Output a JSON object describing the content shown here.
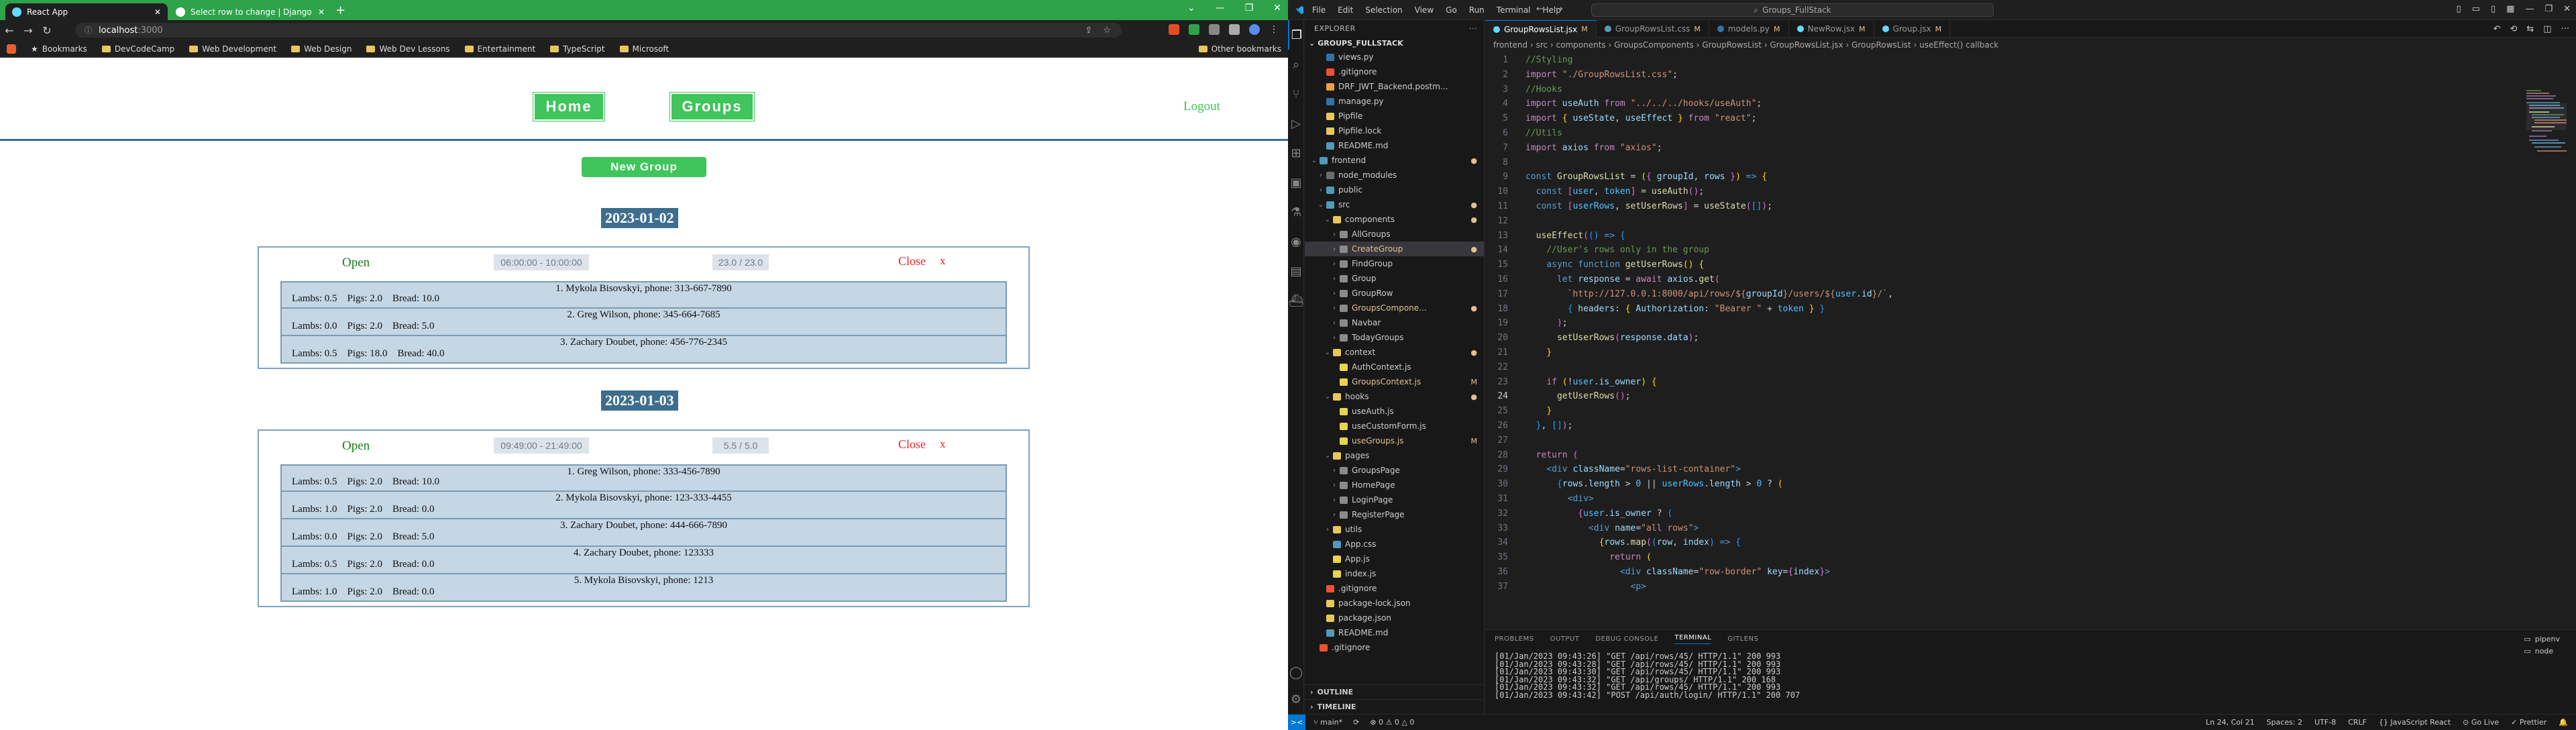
{
  "browser": {
    "tabs": [
      {
        "label": "React App",
        "favicon_color": "#61dafb"
      },
      {
        "label": "Select row to change | Django site",
        "favicon_color": "#ffffff"
      }
    ],
    "new_tab": "+",
    "window_controls": [
      "⌄",
      "—",
      "❐",
      "✕"
    ],
    "url": {
      "host": "localhost",
      "port": ":3000"
    },
    "bookmarks": [
      "Bookmarks",
      "DevCodeCamp",
      "Web Development",
      "Web Design",
      "Web Dev Lessons",
      "Entertainment",
      "TypeScript",
      "Microsoft"
    ],
    "other_bookmarks": "Other bookmarks"
  },
  "app": {
    "nav": {
      "home": "Home",
      "groups": "Groups",
      "logout": "Logout"
    },
    "new_group": "New Group",
    "groups": [
      {
        "date": "2023-01-02",
        "status": "Open",
        "time": "06:00:00 - 10:00:00",
        "count": "23.0 / 23.0",
        "close": "Close",
        "x": "x",
        "rows": [
          {
            "name": "1. Mykola Bisovskyi, phone: 313-667-7890",
            "values": "Lambs: 0.5    Pigs: 2.0    Bread: 10.0"
          },
          {
            "name": "2. Greg Wilson, phone: 345-664-7685",
            "values": "Lambs: 0.0    Pigs: 2.0    Bread: 5.0"
          },
          {
            "name": "3. Zachary Doubet, phone: 456-776-2345",
            "values": "Lambs: 0.5    Pigs: 18.0    Bread: 40.0"
          }
        ]
      },
      {
        "date": "2023-01-03",
        "status": "Open",
        "time": "09:49:00 - 21:49:00",
        "count": "5.5 / 5.0",
        "close": "Close",
        "x": "x",
        "rows": [
          {
            "name": "1. Greg Wilson, phone: 333-456-7890",
            "values": "Lambs: 0.5    Pigs: 2.0    Bread: 10.0"
          },
          {
            "name": "2. Mykola Bisovskyi, phone: 123-333-4455",
            "values": "Lambs: 1.0    Pigs: 2.0    Bread: 0.0"
          },
          {
            "name": "3. Zachary Doubet, phone: 444-666-7890",
            "values": "Lambs: 0.0    Pigs: 2.0    Bread: 5.0"
          },
          {
            "name": "4. Zachary Doubet, phone: 123333",
            "values": "Lambs: 0.5    Pigs: 2.0    Bread: 0.0"
          },
          {
            "name": "5. Mykola Bisovskyi, phone: 1213",
            "values": "Lambs: 1.0    Pigs: 2.0    Bread: 0.0"
          }
        ]
      }
    ]
  },
  "vscode": {
    "menu": [
      "File",
      "Edit",
      "Selection",
      "View",
      "Go",
      "Run",
      "Terminal",
      "Help"
    ],
    "search": "Groups_FullStack",
    "explorer_title": "EXPLORER",
    "root": "GROUPS_FULLSTACK",
    "tree": [
      {
        "label": "views.py",
        "indent": 1,
        "color": "#3572a5"
      },
      {
        "label": ".gitignore",
        "indent": 1,
        "color": "#f05033"
      },
      {
        "label": "DRF_JWT_Backend.postm...",
        "indent": 1,
        "color": "#e8a33d"
      },
      {
        "label": "manage.py",
        "indent": 1,
        "color": "#3572a5"
      },
      {
        "label": "Pipfile",
        "indent": 1,
        "color": "#e8c65b"
      },
      {
        "label": "Pipfile.lock",
        "indent": 1,
        "color": "#e8c65b"
      },
      {
        "label": "README.md",
        "indent": 1,
        "color": "#519aba"
      },
      {
        "label": "frontend",
        "indent": 0,
        "color": "#519aba",
        "folder": true,
        "open": true,
        "mark": "●",
        "mark_color": "#e2c08d"
      },
      {
        "label": "node_modules",
        "indent": 1,
        "color": "#6c6c6c",
        "folder": true
      },
      {
        "label": "public",
        "indent": 1,
        "color": "#519aba",
        "folder": true
      },
      {
        "label": "src",
        "indent": 1,
        "color": "#519aba",
        "folder": true,
        "open": true,
        "mark": "●",
        "mark_color": "#e2c08d"
      },
      {
        "label": "components",
        "indent": 2,
        "color": "#e8c65b",
        "folder": true,
        "open": true,
        "mark": "●",
        "mark_color": "#e2c08d"
      },
      {
        "label": "AllGroups",
        "indent": 3,
        "color": "#8a8a8a",
        "folder": true
      },
      {
        "label": "CreateGroup",
        "indent": 3,
        "color": "#8a8a8a",
        "folder": true,
        "mark": "●",
        "mark_color": "#e2c08d",
        "label_color": "#e2c08d"
      },
      {
        "label": "FindGroup",
        "indent": 3,
        "color": "#8a8a8a",
        "folder": true
      },
      {
        "label": "Group",
        "indent": 3,
        "color": "#8a8a8a",
        "folder": true
      },
      {
        "label": "GroupRow",
        "indent": 3,
        "color": "#8a8a8a",
        "folder": true
      },
      {
        "label": "GroupsCompone...",
        "indent": 3,
        "color": "#8a8a8a",
        "folder": true,
        "mark": "●",
        "mark_color": "#e2c08d",
        "label_color": "#e2c08d"
      },
      {
        "label": "Navbar",
        "indent": 3,
        "color": "#8a8a8a",
        "folder": true
      },
      {
        "label": "TodayGroups",
        "indent": 3,
        "color": "#8a8a8a",
        "folder": true
      },
      {
        "label": "context",
        "indent": 2,
        "color": "#e8c65b",
        "folder": true,
        "open": true,
        "mark": "●",
        "mark_color": "#e2c08d"
      },
      {
        "label": "AuthContext.js",
        "indent": 3,
        "color": "#e8d44d"
      },
      {
        "label": "GroupsContext.js",
        "indent": 3,
        "color": "#e8d44d",
        "mark": "M",
        "mark_color": "#e2c08d",
        "label_color": "#e2c08d"
      },
      {
        "label": "hooks",
        "indent": 2,
        "color": "#e8c65b",
        "folder": true,
        "open": true,
        "mark": "●",
        "mark_color": "#e2c08d"
      },
      {
        "label": "useAuth.js",
        "indent": 3,
        "color": "#e8d44d"
      },
      {
        "label": "useCustomForm.js",
        "indent": 3,
        "color": "#e8d44d"
      },
      {
        "label": "useGroups.js",
        "indent": 3,
        "color": "#e8d44d",
        "mark": "M",
        "mark_color": "#e2c08d",
        "label_color": "#e2c08d"
      },
      {
        "label": "pages",
        "indent": 2,
        "color": "#e8c65b",
        "folder": true,
        "open": true
      },
      {
        "label": "GroupsPage",
        "indent": 3,
        "color": "#8a8a8a",
        "folder": true
      },
      {
        "label": "HomePage",
        "indent": 3,
        "color": "#8a8a8a",
        "folder": true
      },
      {
        "label": "LoginPage",
        "indent": 3,
        "color": "#8a8a8a",
        "folder": true
      },
      {
        "label": "RegisterPage",
        "indent": 3,
        "color": "#8a8a8a",
        "folder": true
      },
      {
        "label": "utils",
        "indent": 2,
        "color": "#e8c65b",
        "folder": true
      },
      {
        "label": "App.css",
        "indent": 2,
        "color": "#519aba"
      },
      {
        "label": "App.js",
        "indent": 2,
        "color": "#e8d44d"
      },
      {
        "label": "index.js",
        "indent": 2,
        "color": "#e8d44d"
      },
      {
        "label": ".gitignore",
        "indent": 1,
        "color": "#f05033"
      },
      {
        "label": "package-lock.json",
        "indent": 1,
        "color": "#e8c65b"
      },
      {
        "label": "package.json",
        "indent": 1,
        "color": "#e8c65b"
      },
      {
        "label": "README.md",
        "indent": 1,
        "color": "#519aba"
      },
      {
        "label": ".gitignore",
        "indent": 0,
        "color": "#f05033"
      }
    ],
    "outline": "OUTLINE",
    "timeline": "TIMELINE",
    "editor_tabs": [
      {
        "label": "GroupRowsList.jsx",
        "mark": "M",
        "active": true,
        "color": "#61dafb"
      },
      {
        "label": "GroupRowsList.css",
        "mark": "M",
        "active": false,
        "color": "#519aba"
      },
      {
        "label": "models.py",
        "mark": "M",
        "active": false,
        "color": "#3572a5"
      },
      {
        "label": "NewRow.jsx",
        "mark": "M",
        "active": false,
        "color": "#61dafb"
      },
      {
        "label": "Group.jsx",
        "mark": "M",
        "active": false,
        "color": "#61dafb"
      }
    ],
    "breadcrumb": "frontend › src › components › GroupsComponents › GroupRowsList › GroupRowsList.jsx › GroupRowsList › useEffect() callback",
    "code_lines": [
      {
        "n": "1",
        "html": "<span class='cm'>//Styling</span>"
      },
      {
        "n": "2",
        "html": "<span class='k'>import</span> <span class='str'>\"./GroupRowsList.css\"</span>;"
      },
      {
        "n": "3",
        "html": "<span class='cm'>//Hooks</span>"
      },
      {
        "n": "4",
        "html": "<span class='k'>import</span> <span class='var'>useAuth</span> <span class='k'>from</span> <span class='str'>\"../../../hooks/useAuth\"</span>;"
      },
      {
        "n": "5",
        "html": "<span class='k'>import</span> <span class='br'>{</span> <span class='var'>useState</span>, <span class='var'>useEffect</span> <span class='br'>}</span> <span class='k'>from</span> <span class='str'>\"react\"</span>;"
      },
      {
        "n": "6",
        "html": "<span class='cm'>//Utils</span>"
      },
      {
        "n": "7",
        "html": "<span class='k'>import</span> <span class='var'>axios</span> <span class='k'>from</span> <span class='str'>\"axios\"</span>;"
      },
      {
        "n": "8",
        "html": ""
      },
      {
        "n": "9",
        "html": "<span class='kw'>const</span> <span class='fn'>GroupRowsList</span> = <span class='br'>(</span><span class='br2'>{</span> <span class='var'>groupId</span>, <span class='var'>rows</span> <span class='br2'>}</span><span class='br'>)</span> <span class='kw'>=&gt;</span> <span class='br'>{</span>"
      },
      {
        "n": "10",
        "html": "  <span class='kw'>const</span> <span class='br2'>[</span><span class='cn'>user</span>, <span class='cn'>token</span><span class='br2'>]</span> = <span class='fn'>useAuth</span><span class='br2'>()</span>;"
      },
      {
        "n": "11",
        "html": "  <span class='kw'>const</span> <span class='br2'>[</span><span class='cn'>userRows</span>, <span class='fn'>setUserRows</span><span class='br2'>]</span> = <span class='fn'>useState</span><span class='br2'>(</span><span class='br3'>[]</span><span class='br2'>)</span>;"
      },
      {
        "n": "12",
        "html": ""
      },
      {
        "n": "13",
        "html": "  <span class='fn'>useEffect</span><span class='br2'>(</span><span class='br3'>()</span> <span class='kw'>=&gt;</span> <span class='br3'>{</span>"
      },
      {
        "n": "14",
        "html": "    <span class='cm'>//User's rows only in the group</span>"
      },
      {
        "n": "15",
        "html": "    <span class='kw'>async</span> <span class='kw'>function</span> <span class='fn'>getUserRows</span><span class='br'>()</span> <span class='br'>{</span>"
      },
      {
        "n": "16",
        "html": "      <span class='kw'>let</span> <span class='var'>response</span> = <span class='k'>await</span> <span class='var'>axios</span>.<span class='fn'>get</span><span class='br2'>(</span>"
      },
      {
        "n": "17",
        "html": "        <span class='str'>`http://127.0.0.1:8000/api/rows/${</span><span class='var'>groupId</span><span class='str'>}/users/${</span><span class='cn'>user</span>.<span class='var'>id</span><span class='str'>}/`</span>,"
      },
      {
        "n": "18",
        "html": "        <span class='br3'>{</span> <span class='var'>headers</span>: <span class='br'>{</span> <span class='var'>Authorization</span>: <span class='str'>\"Bearer \"</span> + <span class='cn'>token</span> <span class='br'>}</span> <span class='br3'>}</span>"
      },
      {
        "n": "19",
        "html": "      <span class='br2'>)</span>;"
      },
      {
        "n": "20",
        "html": "      <span class='fn'>setUserRows</span><span class='br2'>(</span><span class='var'>response</span>.<span class='var'>data</span><span class='br2'>)</span>;"
      },
      {
        "n": "21",
        "html": "    <span class='br'>}</span>"
      },
      {
        "n": "22",
        "html": ""
      },
      {
        "n": "23",
        "html": "    <span class='k'>if</span> <span class='br'>(</span>!<span class='cn'>user</span>.<span class='var'>is_owner</span><span class='br'>)</span> <span class='br'>{</span>"
      },
      {
        "n": "24",
        "html": "      <span class='fn'>getUserRows</span><span class='br2'>()</span>;"
      },
      {
        "n": "25",
        "html": "    <span class='br'>}</span>"
      },
      {
        "n": "26",
        "html": "  <span class='br3'>}</span>, <span class='br3'>[]</span><span class='br2'>)</span>;"
      },
      {
        "n": "27",
        "html": ""
      },
      {
        "n": "28",
        "html": "  <span class='k'>return</span> <span class='br2'>(</span>"
      },
      {
        "n": "29",
        "html": "    <span class='kw'>&lt;</span><span class='kw'>div</span> <span class='var'>className</span>=<span class='str'>\"rows-list-container\"</span><span class='kw'>&gt;</span>"
      },
      {
        "n": "30",
        "html": "      <span class='br3'>{</span><span class='var'>rows</span>.<span class='var'>length</span> &gt; <span class='cn'>0</span> || <span class='cn'>userRows</span>.<span class='var'>length</span> &gt; <span class='cn'>0</span> ? <span class='br'>(</span>"
      },
      {
        "n": "31",
        "html": "        <span class='kw'>&lt;</span><span class='kw'>div</span><span class='kw'>&gt;</span>"
      },
      {
        "n": "32",
        "html": "          <span class='br2'>{</span><span class='cn'>user</span>.<span class='var'>is_owner</span> ? <span class='br3'>(</span>"
      },
      {
        "n": "33",
        "html": "            <span class='kw'>&lt;</span><span class='kw'>div</span> <span class='var'>name</span>=<span class='str'>\"all rows\"</span><span class='kw'>&gt;</span>"
      },
      {
        "n": "34",
        "html": "              <span class='br'>{</span><span class='var'>rows</span>.<span class='fn'>map</span><span class='br2'>(</span><span class='br3'>(</span><span class='var'>row</span>, <span class='var'>index</span><span class='br3'>)</span> <span class='kw'>=&gt;</span> <span class='br3'>{</span>"
      },
      {
        "n": "35",
        "html": "                <span class='k'>return</span> <span class='br'>(</span>"
      },
      {
        "n": "36",
        "html": "                  <span class='kw'>&lt;</span><span class='kw'>div</span> <span class='var'>className</span>=<span class='str'>\"row-border\"</span> <span class='var'>key</span>=<span class='br2'>{</span><span class='var'>index</span><span class='br2'>}</span><span class='kw'>&gt;</span>"
      },
      {
        "n": "37",
        "html": "                    <span class='kw'>&lt;</span><span class='kw'>p</span><span class='kw'>&gt;</span>"
      }
    ],
    "panel_tabs": [
      "PROBLEMS",
      "OUTPUT",
      "DEBUG CONSOLE",
      "TERMINAL",
      "GITLENS"
    ],
    "terminal_lines": [
      "[01/Jan/2023 09:43:26] \"GET /api/rows/45/ HTTP/1.1\" 200 993",
      "[01/Jan/2023 09:43:28] \"GET /api/rows/45/ HTTP/1.1\" 200 993",
      "[01/Jan/2023 09:43:30] \"GET /api/rows/45/ HTTP/1.1\" 200 993",
      "[01/Jan/2023 09:43:32] \"GET /api/groups/ HTTP/1.1\" 200 168",
      "[01/Jan/2023 09:43:32] \"GET /api/rows/45/ HTTP/1.1\" 200 993",
      "[01/Jan/2023 09:43:42] \"POST /api/auth/login/ HTTP/1.1\" 200 707"
    ],
    "terminals": [
      "pipenv",
      "node"
    ],
    "status": {
      "remote": "><",
      "branch": "main*",
      "sync": "⟳",
      "problems": "⊗ 0 ⚠ 0 △ 0",
      "position": "Ln 24, Col 21",
      "spaces": "Spaces: 2",
      "encoding": "UTF-8",
      "eol": "CRLF",
      "language": "{} JavaScript React",
      "golive": "⊙ Go Live",
      "prettier": "✓ Prettier",
      "bell": "🔔"
    }
  }
}
